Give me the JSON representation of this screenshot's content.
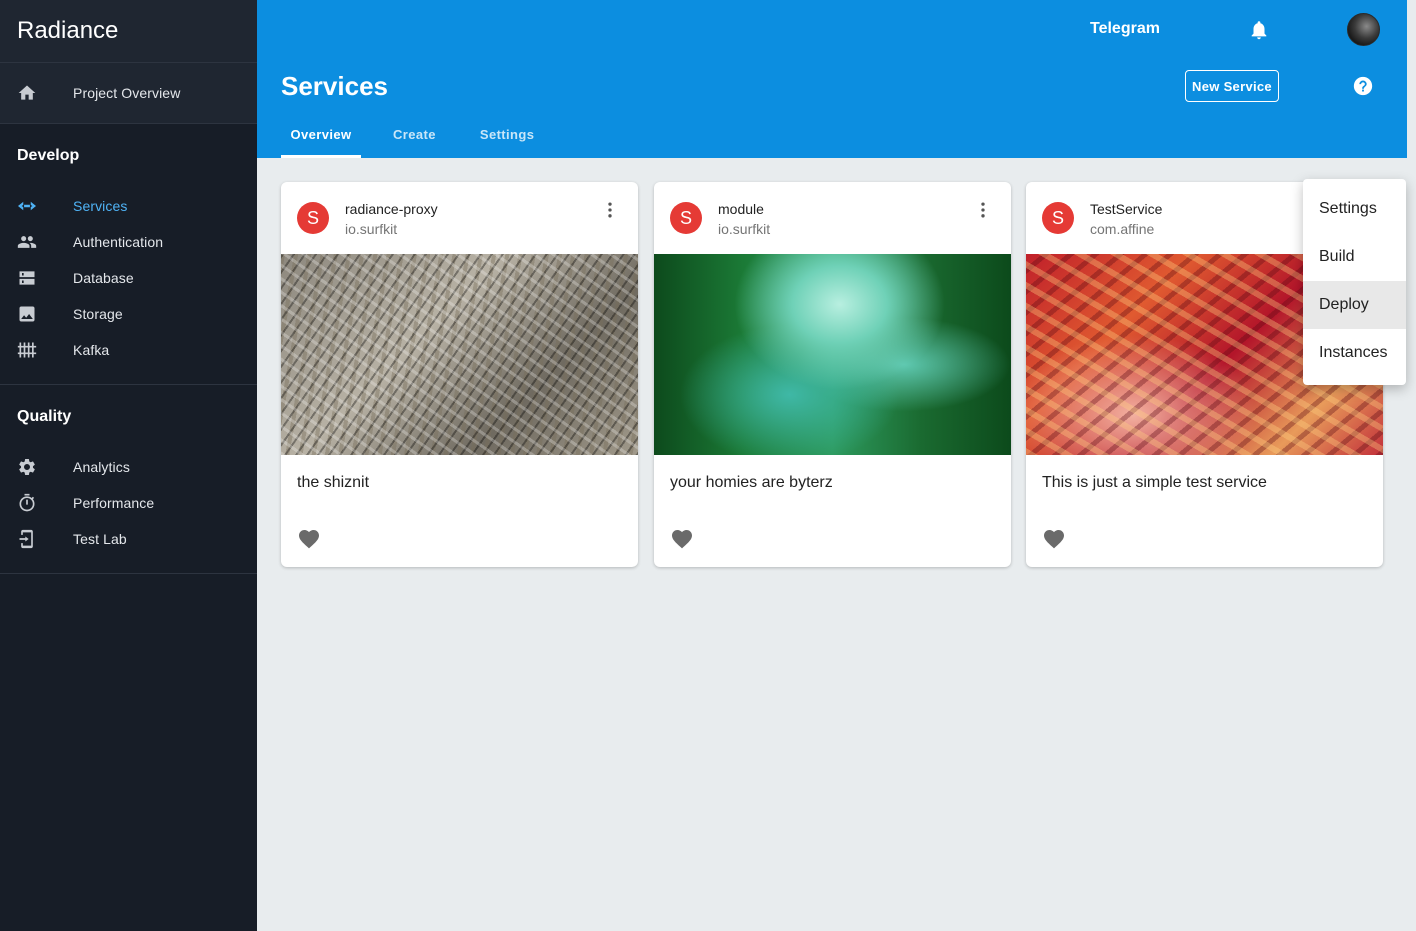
{
  "app": {
    "name": "Radiance"
  },
  "sidebar": {
    "overview": {
      "label": "Project Overview",
      "icon": "home-icon"
    },
    "sections": [
      {
        "title": "Develop",
        "items": [
          {
            "label": "Services",
            "icon": "code-icon",
            "active": true
          },
          {
            "label": "Authentication",
            "icon": "people-icon"
          },
          {
            "label": "Database",
            "icon": "storage-rows-icon"
          },
          {
            "label": "Storage",
            "icon": "image-icon"
          },
          {
            "label": "Kafka",
            "icon": "grid-dots-icon"
          }
        ]
      },
      {
        "title": "Quality",
        "items": [
          {
            "label": "Analytics",
            "icon": "gear-icon"
          },
          {
            "label": "Performance",
            "icon": "timer-icon"
          },
          {
            "label": "Test Lab",
            "icon": "device-icon"
          }
        ]
      }
    ]
  },
  "header": {
    "project": "Telegram",
    "title": "Services",
    "new_button": "New Service",
    "tabs": [
      {
        "label": "Overview",
        "active": true
      },
      {
        "label": "Create"
      },
      {
        "label": "Settings"
      }
    ]
  },
  "cards": [
    {
      "avatar": "S",
      "title": "radiance-proxy",
      "subtitle": "io.surfkit",
      "description": "the shiznit"
    },
    {
      "avatar": "S",
      "title": "module",
      "subtitle": "io.surfkit",
      "description": "your homies are byterz"
    },
    {
      "avatar": "S",
      "title": "TestService",
      "subtitle": "com.affine",
      "description": "This is just a simple test service"
    }
  ],
  "menu": {
    "items": [
      {
        "label": "Settings"
      },
      {
        "label": "Build"
      },
      {
        "label": "Deploy",
        "highlighted": true
      },
      {
        "label": "Instances"
      }
    ]
  },
  "colors": {
    "sidebar_bg": "#171d27",
    "header_bg": "#0c8ee0",
    "accent": "#4fb3f6",
    "avatar_bg": "#e53a35",
    "page_bg": "#e8ecee"
  }
}
